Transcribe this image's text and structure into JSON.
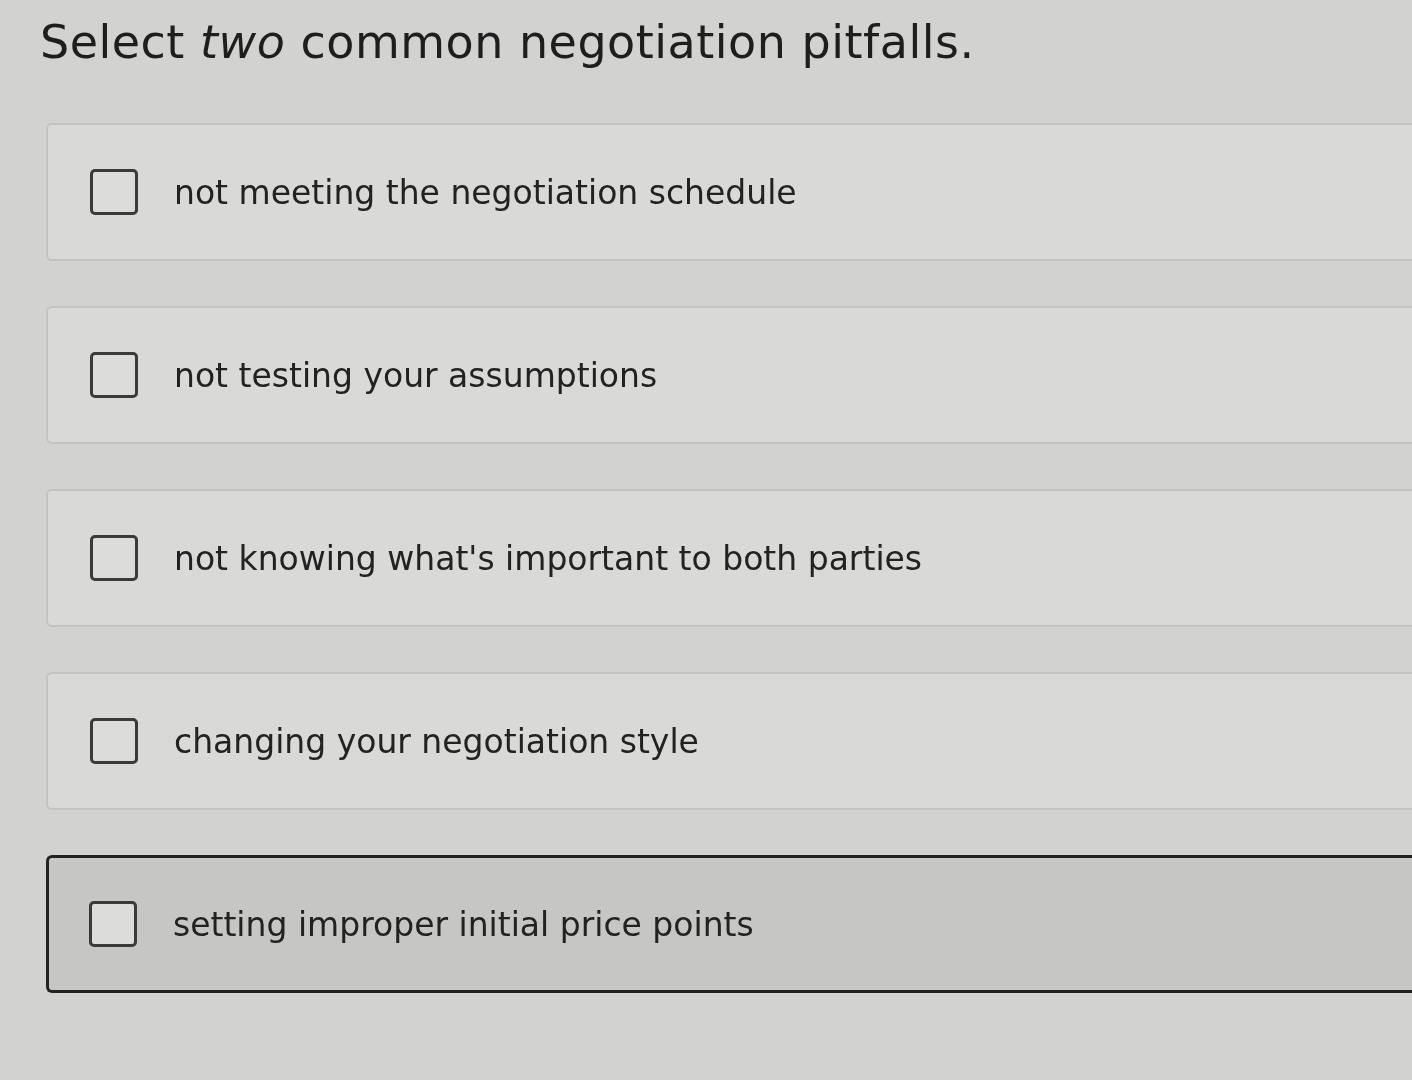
{
  "question": {
    "prompt": "Select *two* common negotiation pitfalls."
  },
  "options": [
    {
      "label": "not meeting the negotiation schedule",
      "checked": false,
      "hovered": false
    },
    {
      "label": "not testing your assumptions",
      "checked": false,
      "hovered": false
    },
    {
      "label": "not knowing what's important to both parties",
      "checked": false,
      "hovered": false
    },
    {
      "label": "changing your negotiation style",
      "checked": false,
      "hovered": false
    },
    {
      "label": "setting improper initial price points",
      "checked": false,
      "hovered": true
    }
  ]
}
